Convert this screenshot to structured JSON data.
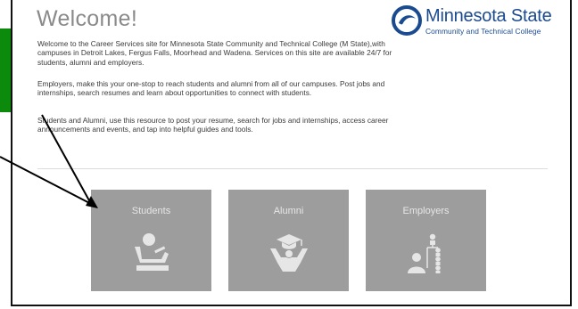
{
  "page": {
    "title": "Welcome!",
    "paragraphs": [
      "Welcome to the Career Services site for Minnesota State Community and Technical College (M State),with campuses in Detroit Lakes, Fergus Falls, Moorhead and Wadena. Services on this site are available 24/7 for students, alumni and employers.",
      "Employers, make this your one-stop to reach students and alumni from all of our campuses. Post jobs and internships, search resumes and learn about opportunities to connect with students.",
      "Students and Alumni, use this resource to post your resume, search for jobs and internships, access career announcements and events, and tap into helpful guides and tools."
    ]
  },
  "logo": {
    "name": "Minnesota State",
    "subtitle": "Community and Technical College",
    "icon": "m-state-swirl-icon",
    "color": "#1a4a8f"
  },
  "tiles": [
    {
      "label": "Students",
      "icon": "student-at-desk-icon"
    },
    {
      "label": "Alumni",
      "icon": "graduate-cheering-icon"
    },
    {
      "label": "Employers",
      "icon": "employer-org-chart-icon"
    }
  ],
  "annotation": {
    "marker_color": "#0b8a0b",
    "arrow_color": "#000000"
  },
  "colors": {
    "tile_bg": "#9d9d9d",
    "tile_fg": "#e6e6e6",
    "title": "#8a8a8a"
  }
}
